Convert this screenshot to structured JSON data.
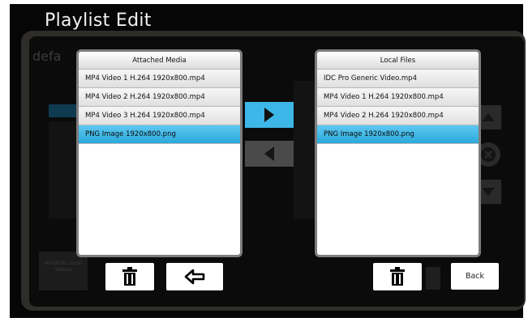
{
  "title": "Playlist Edit",
  "background_playlist_name": "defa",
  "background_add_button_label": "Add/Edit Local Videos",
  "attached": {
    "header": "Attached Media",
    "items": [
      {
        "label": "MP4 Video 1 H.264 1920x800.mp4",
        "selected": false
      },
      {
        "label": "MP4 Video 2 H.264 1920x800.mp4",
        "selected": false
      },
      {
        "label": "MP4 Video 3 H.264 1920x800.mp4",
        "selected": false
      },
      {
        "label": "PNG Image 1920x800.png",
        "selected": true
      }
    ]
  },
  "local": {
    "header": "Local Files",
    "items": [
      {
        "label": "IDC Pro Generic Video.mp4",
        "selected": false
      },
      {
        "label": "MP4 Video 1 H.264 1920x800.mp4",
        "selected": false
      },
      {
        "label": "MP4 Video 2 H.264 1920x800.mp4",
        "selected": false
      },
      {
        "label": "PNG Image 1920x800.png",
        "selected": true
      }
    ]
  },
  "buttons": {
    "back_label": "Back",
    "move_right_icon": "play-right-icon",
    "move_left_icon": "play-left-icon",
    "delete_icon": "trash-icon",
    "undo_icon": "undo-arrow-icon"
  },
  "colors": {
    "accent": "#3db6e8",
    "selected_row": "#3fb3e4",
    "frame": "#2e2d2a",
    "background": "#060606"
  }
}
